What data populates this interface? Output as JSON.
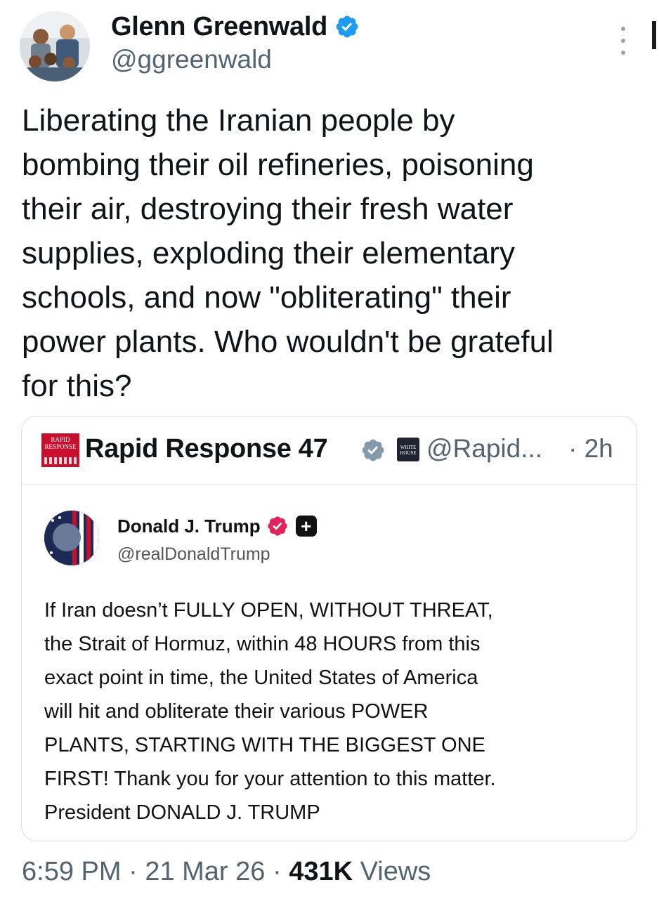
{
  "author": {
    "display_name": "Glenn Greenwald",
    "handle": "@ggreenwald",
    "verified_color": "#1d9bf0"
  },
  "tweet": {
    "text": "Liberating the Iranian people by\nbombing their oil refineries, poisoning\ntheir air, destroying their fresh water\nsupplies, exploding their elementary\nschools, and now \"obliterating\" their\npower plants. Who wouldn't be grateful\nfor this?"
  },
  "quote": {
    "logo_text": "RAPID RESPONSE",
    "display_name": "Rapid Response 47",
    "affiliate_badge_text": "WHITE HOUSE",
    "handle": "@Rapid...",
    "time": "· 2h",
    "embedded": {
      "display_name": "Donald J. Trump",
      "handle": "@realDonaldTrump",
      "plus_badge": "+",
      "badge_color": "#e0245e",
      "text": "If Iran doesn’t FULLY OPEN, WITHOUT THREAT,\nthe Strait of Hormuz, within 48 HOURS from this\nexact point in time, the United States of America\nwill hit and obliterate their various POWER\nPLANTS, STARTING WITH THE BIGGEST ONE\nFIRST! Thank you for your attention to this matter.\nPresident DONALD J. TRUMP"
    }
  },
  "meta": {
    "time": "6:59 PM",
    "separator": " · ",
    "date": "21 Mar 26",
    "views_count": "431K",
    "views_label": " Views"
  }
}
